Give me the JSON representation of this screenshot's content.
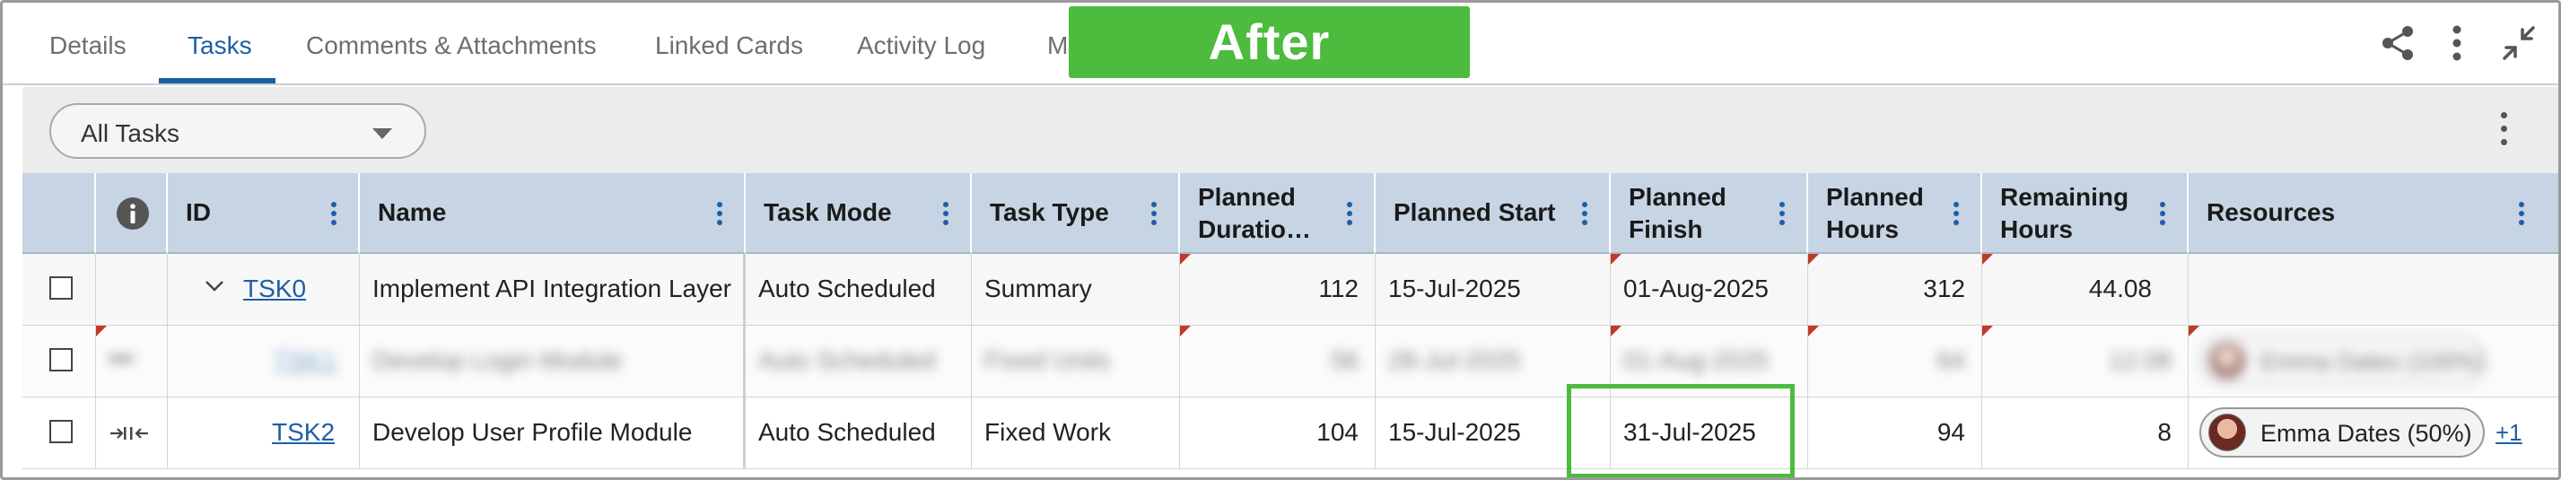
{
  "tabs": [
    {
      "label": "Details",
      "active": false
    },
    {
      "label": "Tasks",
      "active": true
    },
    {
      "label": "Comments & Attachments",
      "active": false
    },
    {
      "label": "Linked Cards",
      "active": false
    },
    {
      "label": "Activity Log",
      "active": false
    },
    {
      "label": "M",
      "active": false
    }
  ],
  "badge": "After",
  "top_icons": [
    "share-icon",
    "more-vertical-icon",
    "collapse-icon"
  ],
  "filter": {
    "selected": "All Tasks"
  },
  "columns": [
    {
      "label": "",
      "type": "checkbox"
    },
    {
      "label": "",
      "type": "info-icon"
    },
    {
      "label": "ID"
    },
    {
      "label": "Name"
    },
    {
      "label": "Task Mode"
    },
    {
      "label": "Task Type"
    },
    {
      "label": "Planned Duratio…",
      "line1": "Planned",
      "line2": "Duratio…"
    },
    {
      "label": "Planned Start"
    },
    {
      "label": "Planned Finish",
      "line1": "Planned",
      "line2": "Finish"
    },
    {
      "label": "Planned Hours",
      "line1": "Planned",
      "line2": "Hours"
    },
    {
      "label": "Remaining Hours",
      "line1": "Remaining",
      "line2": "Hours"
    },
    {
      "label": "Resources"
    }
  ],
  "rows": [
    {
      "id": "TSK0",
      "name": "Implement API Integration Layer",
      "task_mode": "Auto Scheduled",
      "task_type": "Summary",
      "planned_duration": "112",
      "planned_start": "15-Jul-2025",
      "planned_finish": "01-Aug-2025",
      "planned_hours": "312",
      "remaining_hours": "44.08",
      "resource": "",
      "expanded": true
    },
    {
      "id": "TSK1",
      "name": "Develop Login Module",
      "task_mode": "Auto Scheduled",
      "task_type": "Fixed Units",
      "planned_duration": "56",
      "planned_start": "28-Jul-2025",
      "planned_finish": "01-Aug-2025",
      "planned_hours": "64",
      "remaining_hours": "12.08",
      "resource": "Emma Dates (100%)",
      "blurred": true
    },
    {
      "id": "TSK2",
      "name": "Develop User Profile Module",
      "task_mode": "Auto Scheduled",
      "task_type": "Fixed Work",
      "planned_duration": "104",
      "planned_start": "15-Jul-2025",
      "planned_finish": "31-Jul-2025",
      "planned_hours": "94",
      "remaining_hours": "8",
      "resource": "Emma Dates (50%)",
      "resource_more": "+1"
    }
  ]
}
